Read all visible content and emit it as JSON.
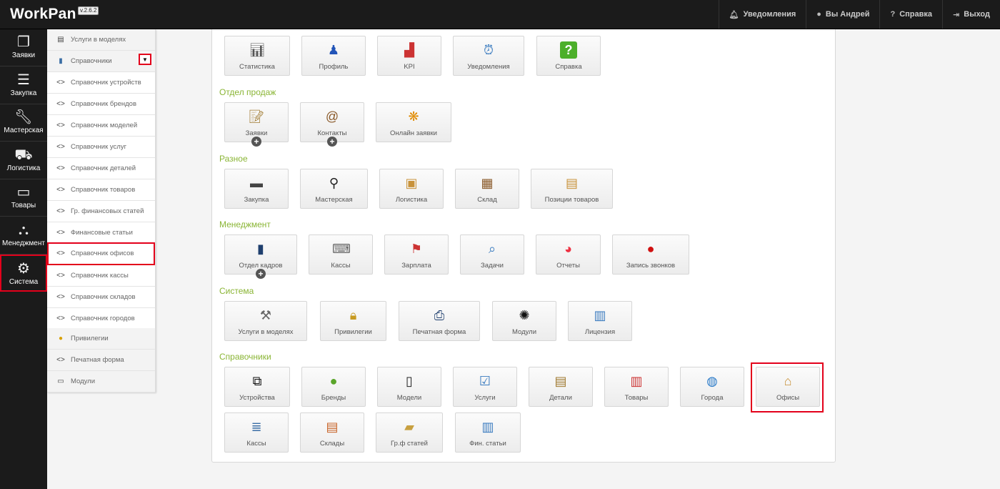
{
  "app": {
    "logo": "WorkPan",
    "version": "v.2.6.2"
  },
  "topnav": [
    {
      "label": "Уведомления",
      "icon": "bell-icon"
    },
    {
      "label": "Вы Андрей",
      "icon": "user-icon"
    },
    {
      "label": "Справка",
      "icon": "help-icon"
    },
    {
      "label": "Выход",
      "icon": "logout-icon"
    }
  ],
  "leftnav": [
    {
      "label": "Заявки",
      "icon": "documents-icon"
    },
    {
      "label": "Закупка",
      "icon": "bars-icon"
    },
    {
      "label": "Мастерская",
      "icon": "wrench-icon"
    },
    {
      "label": "Логистика",
      "icon": "truck-icon"
    },
    {
      "label": "Товары",
      "icon": "drive-icon"
    },
    {
      "label": "Менеджмент",
      "icon": "org-chart-icon"
    },
    {
      "label": "Система",
      "icon": "gears-icon"
    }
  ],
  "submenu": [
    {
      "label": "Услуги в моделях"
    },
    {
      "label": "Справочники"
    },
    {
      "label": "Справочник устройств"
    },
    {
      "label": "Справочник брендов"
    },
    {
      "label": "Справочник моделей"
    },
    {
      "label": "Справочник услуг"
    },
    {
      "label": "Справочник деталей"
    },
    {
      "label": "Справочник товаров"
    },
    {
      "label": "Гр. финансовых статей"
    },
    {
      "label": "Финансовые статьи"
    },
    {
      "label": "Справочник офисов"
    },
    {
      "label": "Справочник кассы"
    },
    {
      "label": "Справочник складов"
    },
    {
      "label": "Справочник городов"
    },
    {
      "label": "Привилегии"
    },
    {
      "label": "Печатная форма"
    },
    {
      "label": "Модули"
    }
  ],
  "sections": {
    "sales": "Отдел продаж",
    "misc": "Разное",
    "management": "Менеджмент",
    "system": "Система",
    "directories": "Справочники"
  },
  "tiles": {
    "top": [
      "Статистика",
      "Профиль",
      "KPI",
      "Уведомления",
      "Справка"
    ],
    "sales": [
      "Заявки",
      "Контакты",
      "Онлайн заявки"
    ],
    "misc": [
      "Закупка",
      "Мастерская",
      "Логистика",
      "Склад",
      "Позиции товаров"
    ],
    "management": [
      "Отдел кадров",
      "Кассы",
      "Зарплата",
      "Задачи",
      "Отчеты",
      "Запись звонков"
    ],
    "system": [
      "Услуги в моделях",
      "Привилегии",
      "Печатная форма",
      "Модули",
      "Лицензия"
    ],
    "directories": [
      "Устройства",
      "Бренды",
      "Модели",
      "Услуги",
      "Детали",
      "Товары",
      "Города",
      "Офисы",
      "Кассы",
      "Склады",
      "Гр.ф статей",
      "Фин. статьи"
    ]
  },
  "colors": {
    "accent_green": "#8ab535",
    "highlight_red": "#e3001b",
    "dark_bar": "#1b1b1b"
  }
}
